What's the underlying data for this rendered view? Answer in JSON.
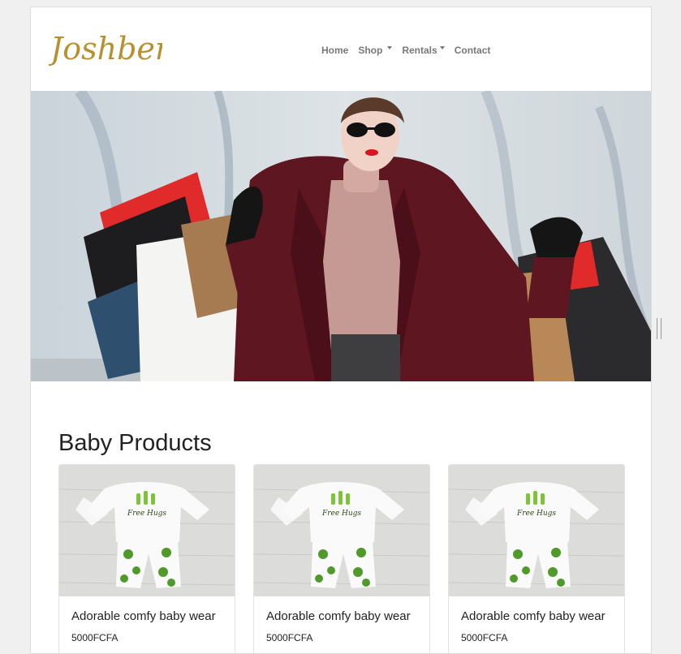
{
  "brand": {
    "logo_text": "Joshbert"
  },
  "nav": {
    "items": [
      {
        "label": "Home",
        "dropdown": false
      },
      {
        "label": "Shop",
        "dropdown": true
      },
      {
        "label": "Rentals",
        "dropdown": true
      },
      {
        "label": "Contact",
        "dropdown": false
      }
    ]
  },
  "hero": {
    "icon": "woman-with-shopping-bags-image"
  },
  "products": {
    "title": "Baby Products",
    "items": [
      {
        "name": "Adorable comfy baby wear",
        "price": "5000FCFA",
        "print_text": "Free Hugs"
      },
      {
        "name": "Adorable comfy baby wear",
        "price": "5000FCFA",
        "print_text": "Free Hugs"
      },
      {
        "name": "Adorable comfy baby wear",
        "price": "5000FCFA",
        "print_text": "Free Hugs"
      }
    ]
  },
  "colors": {
    "logo_gold": "#b8902e",
    "nav_text": "#777777",
    "coat": "#5e1620",
    "cactus_green": "#7cc53a"
  }
}
